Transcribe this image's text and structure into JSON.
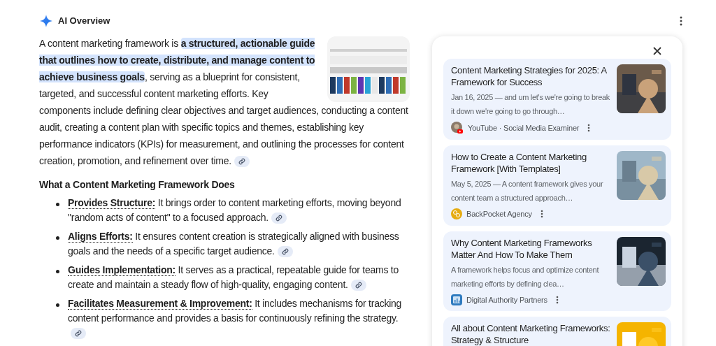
{
  "header": {
    "title": "AI Overview"
  },
  "intro": {
    "before": "A content marketing framework is ",
    "highlight": "a structured, actionable guide that outlines how to create, distribute, and manage content to achieve business goals",
    "after": ", serving as a blueprint for consistent, targeted, and successful content marketing efforts. Key components include defining clear objectives and target audiences, conducting a content audit, creating a content plan with specific topics and themes, establishing key performance indicators (KPIs) for measurement, and outlining the processes for content creation, promotion, and refinement over time."
  },
  "section_heading": "What a Content Marketing Framework Does",
  "bullets": [
    {
      "label": "Provides Structure:",
      "text": " It brings order to content marketing efforts, moving beyond \"random acts of content\" to a focused approach."
    },
    {
      "label": "Aligns Efforts:",
      "text": " It ensures content creation is strategically aligned with business goals and the needs of a specific target audience."
    },
    {
      "label": "Guides Implementation:",
      "text": " It serves as a practical, repeatable guide for teams to create and maintain a steady flow of high-quality, engaging content."
    },
    {
      "label": "Facilitates Measurement & Improvement:",
      "text": " It includes mechanisms for tracking content performance and provides a basis for continuously refining the strategy."
    }
  ],
  "sources": [
    {
      "title": "Content Marketing Strategies for 2025: A Framework for Success",
      "snippet": "Jan 16, 2025 — and um let's we're going to break it down we're going to go through…",
      "site": "YouTube · Social Media Examiner",
      "kind": "video"
    },
    {
      "title": "How to Create a Content Marketing Framework [With Templates]",
      "snippet": "May 5, 2025 — A content framework gives your content team a structured approach…",
      "site": "BackPocket Agency",
      "kind": "coin"
    },
    {
      "title": "Why Content Marketing Frameworks Matter And How To Make Them",
      "snippet": "A framework helps focus and optimize content marketing efforts by defining clea…",
      "site": "Digital Authority Partners",
      "kind": "chart"
    },
    {
      "title": "All about Content Marketing Frameworks: Strategy & Structure"
    }
  ]
}
